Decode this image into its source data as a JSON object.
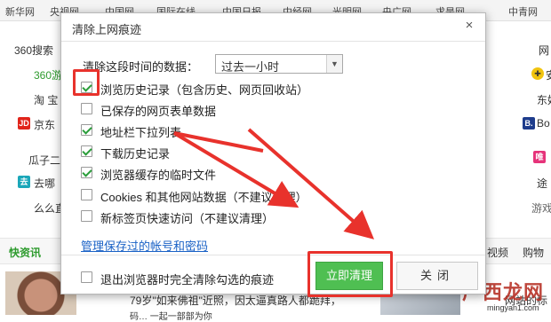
{
  "background": {
    "nav": [
      "新华网",
      "央视网",
      "中国网",
      "国际在线",
      "中国日报",
      "中经网",
      "光明网",
      "央广网",
      "求是网",
      "中青网"
    ],
    "left_links": {
      "search": "360搜索",
      "green": "360游",
      "taobao": "淘 宝",
      "jd": "京东",
      "guazi": "瓜子二",
      "qunar": "去哪",
      "mm": "么么直"
    },
    "right_links": {
      "net": "网",
      "an": "安",
      "dong": "东好",
      "bo": "Bo",
      "wei": "唯",
      "tu": "途",
      "you": "游",
      "youxi": "游戏"
    },
    "bottom_tabs": {
      "news": "快资讯",
      "video": "视频",
      "shop": "购物"
    },
    "news_line1": "79岁\"如来佛祖\"近照，因太逼真路人都跪拜，",
    "news_line2": "码…  一起一部部为你",
    "right_snippet": "网站的标",
    "watermark": "广西龙网",
    "watermark_url": "mingyan1.com",
    "colors": {
      "green": "#2e9b2e",
      "jd_red": "#e1251b",
      "booking_blue": "#1e3c8c",
      "vip_pink": "#e6337a",
      "qunar_teal": "#1ba7b9"
    }
  },
  "dialog": {
    "title": "清除上网痕迹",
    "close_symbol": "×",
    "range_label": "清除这段时间的数据：",
    "range_value": "过去一小时",
    "options": [
      {
        "label": "浏览历史记录（包含历史、网页回收站）",
        "checked": true
      },
      {
        "label": "已保存的网页表单数据",
        "checked": false
      },
      {
        "label": "地址栏下拉列表",
        "checked": true
      },
      {
        "label": "下载历史记录",
        "checked": true
      },
      {
        "label": "浏览器缓存的临时文件",
        "checked": true
      },
      {
        "label": "Cookies 和其他网站数据（不建议清理）",
        "checked": false
      },
      {
        "label": "新标签页快速访问（不建议清理）",
        "checked": false
      }
    ],
    "manage_link": "管理保存过的帐号和密码",
    "footer_option": {
      "label": "退出浏览器时完全清除勾选的痕迹",
      "checked": false
    },
    "clear_button": "立即清理",
    "close_button": "关闭",
    "colors": {
      "clear_button": "#4fbf52",
      "link": "#1a62c6",
      "check": "#2a9d3a",
      "annotation": "#e8322c"
    }
  }
}
